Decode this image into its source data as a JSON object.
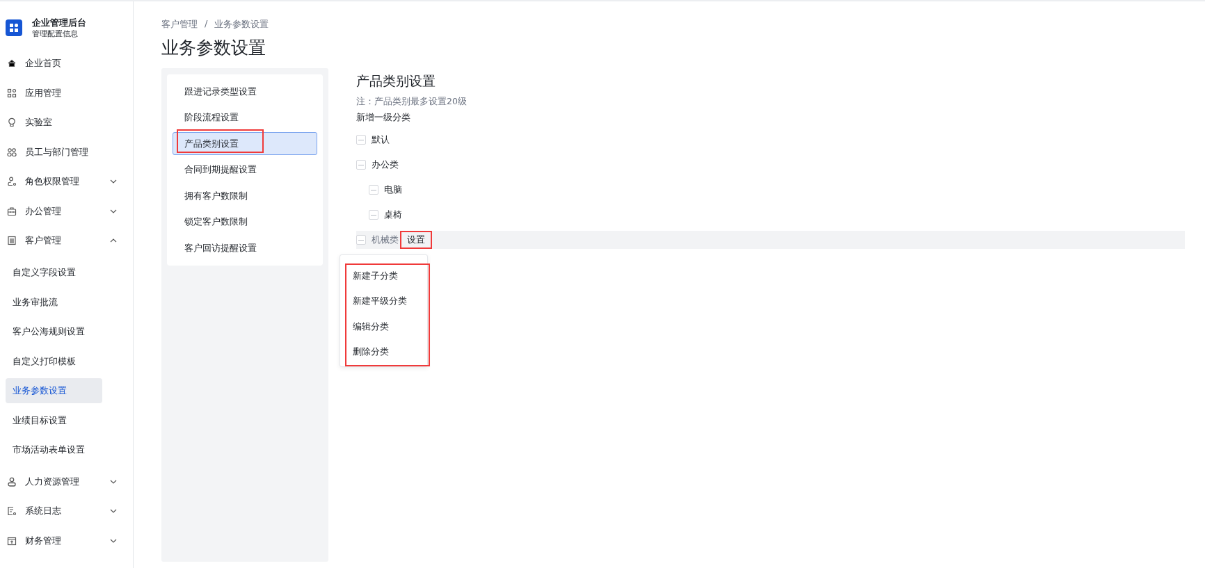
{
  "app": {
    "title": "企业管理后台",
    "subtitle": "管理配置信息"
  },
  "sidebar": {
    "items": [
      {
        "kind": "home",
        "label": "企业首页"
      },
      {
        "kind": "apps",
        "label": "应用管理"
      },
      {
        "kind": "bulb",
        "label": "实验室"
      },
      {
        "kind": "team",
        "label": "员工与部门管理"
      },
      {
        "kind": "role",
        "label": "角色权限管理",
        "expanded": false
      },
      {
        "kind": "briefcase",
        "label": "办公管理",
        "expanded": false
      },
      {
        "kind": "building",
        "label": "客户管理",
        "expanded": true,
        "children": [
          {
            "label": "自定义字段设置",
            "selected": false
          },
          {
            "label": "业务审批流",
            "selected": false
          },
          {
            "label": "客户公海规则设置",
            "selected": false
          },
          {
            "label": "自定义打印模板",
            "selected": false
          },
          {
            "label": "业务参数设置",
            "selected": true
          },
          {
            "label": "业绩目标设置",
            "selected": false
          },
          {
            "label": "市场活动表单设置",
            "selected": false
          }
        ]
      },
      {
        "kind": "user",
        "label": "人力资源管理",
        "expanded": false
      },
      {
        "kind": "log",
        "label": "系统日志",
        "expanded": false
      },
      {
        "kind": "finance",
        "label": "财务管理",
        "expanded": false
      }
    ]
  },
  "breadcrumb": [
    "客户管理",
    "/",
    "业务参数设置"
  ],
  "page_title": "业务参数设置",
  "settings_nav": [
    {
      "label": "跟进记录类型设置",
      "selected": false,
      "annotated": false
    },
    {
      "label": "阶段流程设置",
      "selected": false,
      "annotated": false
    },
    {
      "label": "产品类别设置",
      "selected": true,
      "annotated": true
    },
    {
      "label": "合同到期提醒设置",
      "selected": false,
      "annotated": false
    },
    {
      "label": "拥有客户数限制",
      "selected": false,
      "annotated": false
    },
    {
      "label": "锁定客户数限制",
      "selected": false,
      "annotated": false
    },
    {
      "label": "客户回访提醒设置",
      "selected": false,
      "annotated": false
    }
  ],
  "panel": {
    "title": "产品类别设置",
    "note": "注：产品类别最多设置20级",
    "add_link": "新增一级分类",
    "tree": [
      {
        "label": "默认",
        "hovered": false
      },
      {
        "label": "办公类",
        "hovered": false,
        "children": [
          {
            "label": "电脑",
            "hovered": false
          },
          {
            "label": "桌椅",
            "hovered": false
          }
        ]
      },
      {
        "label": "机械类",
        "hovered": true,
        "action": {
          "label": "设置",
          "annotated": true
        },
        "menu": {
          "annotated": true,
          "items": [
            "新建子分类",
            "新建平级分类",
            "编辑分类",
            "删除分类"
          ]
        }
      }
    ]
  }
}
